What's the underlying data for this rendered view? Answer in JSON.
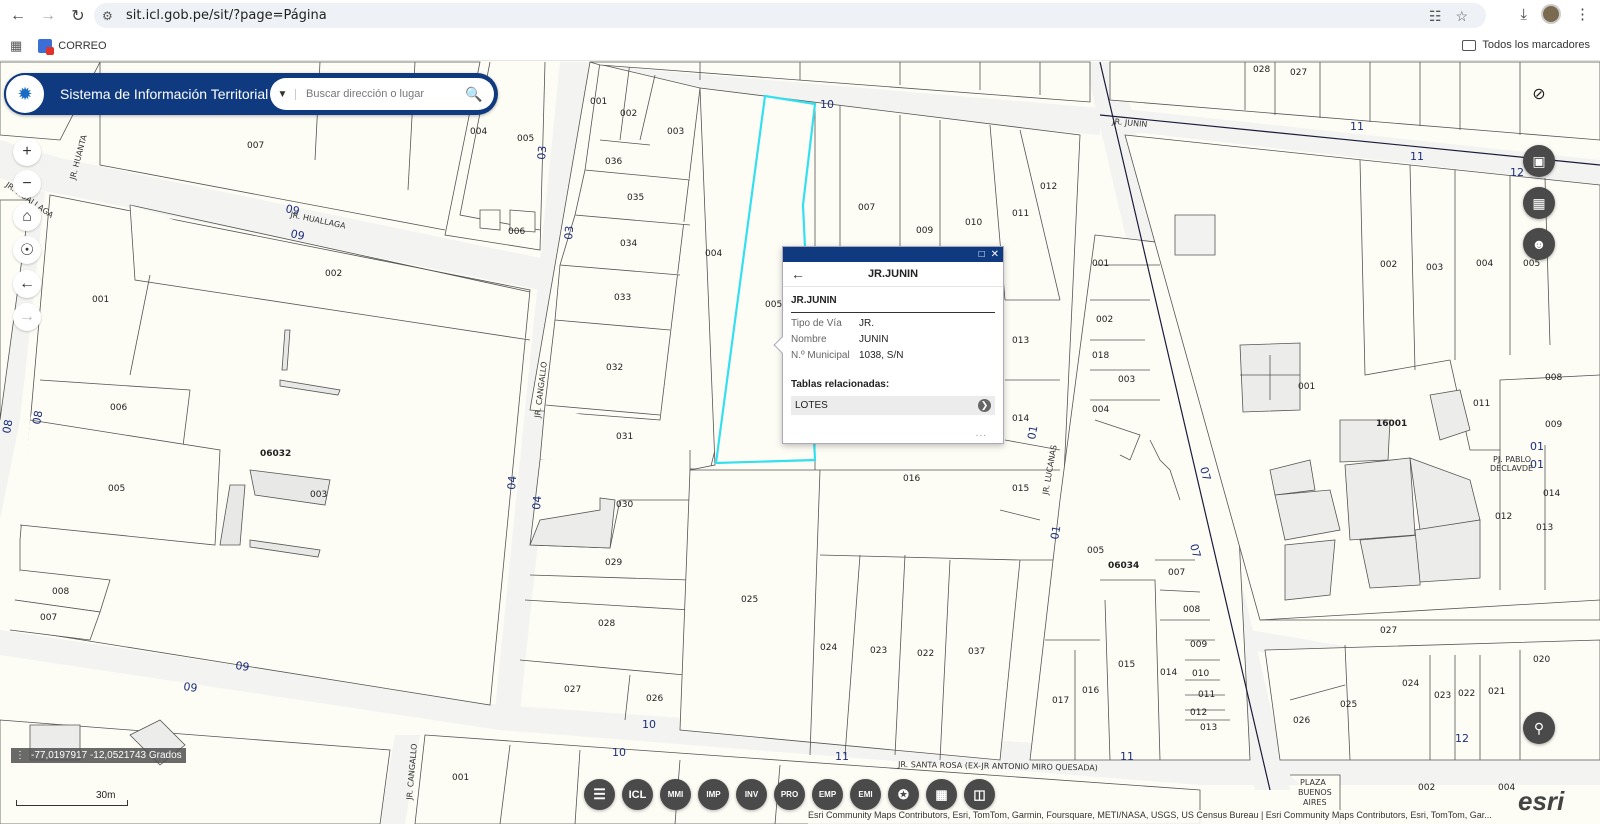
{
  "browser": {
    "url": "sit.icl.gob.pe/sit/?page=Página",
    "bookmark_correo": "CORREO",
    "bookmark_all": "Todos los marcadores"
  },
  "app": {
    "title": "Sistema de Información Territorial",
    "search_placeholder": "Buscar dirección o lugar"
  },
  "popup": {
    "header_title": "JR.JUNIN",
    "feature_name": "JR.JUNIN",
    "attributes": [
      {
        "key": "Tipo de Vía",
        "value": "JR."
      },
      {
        "key": "Nombre",
        "value": "JUNIN"
      },
      {
        "key": "N.º Municipal",
        "value": "1038, S/N"
      }
    ],
    "related_title": "Tablas relacionadas:",
    "related_item": "LOTES",
    "more": "..."
  },
  "toolbar": [
    "ICL",
    "MMI",
    "IMP",
    "INV",
    "PRO",
    "EMP",
    "EMI"
  ],
  "status": {
    "coords": "-77,0197917 -12,0521743 Grados",
    "scale": "30m",
    "attribution": "Esri Community Maps Contributors, Esri, TomTom, Garmin, Foursquare, METI/NASA, USGS, US Census Bureau | Esri Community Maps Contributors, Esri, TomTom, Gar..."
  },
  "map_labels": {
    "block_06032": "06032",
    "block_06034": "06034",
    "block_16001": "16001",
    "street_huallaga": "JR. HUALLAGA",
    "street_huanta": "JR. HUANTA",
    "street_cangallo": "JR. CANGALLO",
    "street_lucanas": "JR. LUCANAS",
    "street_junin": "JR. JUNIN",
    "street_santa_rosa": "JR. SANTA ROSA (EX-JR ANTONIO MIRO QUESADA)",
    "street_pablo": "PJ. PABLO DECLAVDE",
    "plaza": "PLAZA BUENOS AIRES"
  },
  "colors": {
    "header_blue": "#0f3a80",
    "highlight_cyan": "#33e0f0",
    "map_bg": "#fdfcf5",
    "street_fill": "#f3f3f1"
  }
}
